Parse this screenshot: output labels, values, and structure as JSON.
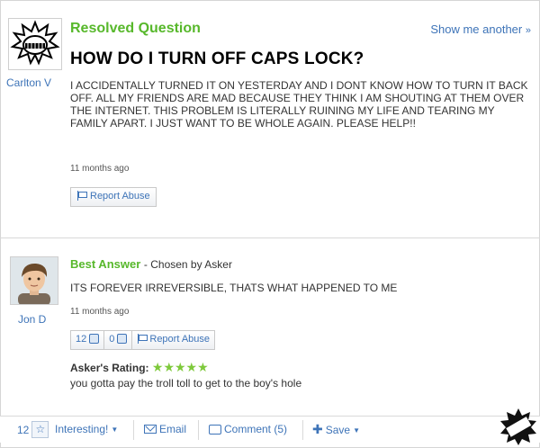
{
  "question": {
    "status": "Resolved Question",
    "show_another": "Show me another",
    "show_another_arrow": "»",
    "asker": "Carlton V",
    "title": "HOW DO I TURN OFF CAPS LOCK?",
    "body": "I ACCIDENTALLY TURNED IT ON YESTERDAY AND I DONT KNOW HOW TO TURN IT BACK OFF. ALL MY FRIENDS ARE MAD BECAUSE THEY THINK I AM SHOUTING AT THEM OVER THE INTERNET. THIS PROBLEM IS LITERALLY RUINING MY LIFE AND TEARING MY FAMILY APART. I JUST WANT TO BE WHOLE AGAIN. PLEASE HELP!!",
    "time": "11 months ago",
    "report_label": "Report Abuse"
  },
  "answer": {
    "heading": "Best Answer",
    "chosen_by": "- Chosen by Asker",
    "answerer": "Jon D",
    "body": "ITS FOREVER IRREVERSIBLE, THATS WHAT HAPPENED TO ME",
    "time": "11 months ago",
    "thumbs_up_count": "12",
    "thumbs_down_count": "0",
    "report_label": "Report Abuse",
    "rating_label": "Asker's Rating:",
    "rating_stars": "★★★★★",
    "rating_value": 5,
    "rating_comment": "you gotta pay the troll toll to get to the boy's hole"
  },
  "toolbar": {
    "star_count": "12",
    "interesting_label": "Interesting!",
    "email_label": "Email",
    "comment_label": "Comment (5)",
    "save_label": "Save"
  },
  "icons": {
    "star": "☆",
    "caret": "▼",
    "plus": "✚"
  },
  "colors": {
    "link": "#3e74b8",
    "accent_green": "#57b82b",
    "stars": "#7ec93b"
  }
}
